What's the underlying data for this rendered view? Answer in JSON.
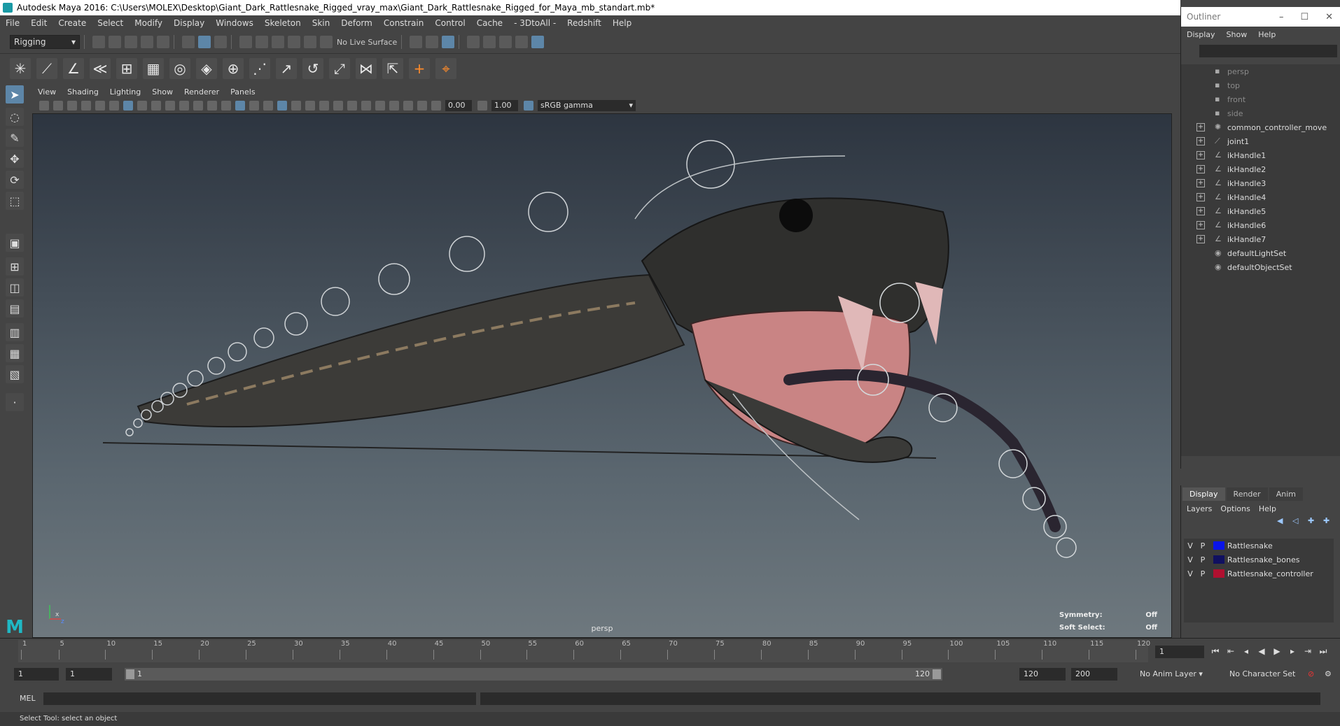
{
  "window": {
    "title": "Autodesk Maya 2016: C:\\Users\\MOLEX\\Desktop\\Giant_Dark_Rattlesnake_Rigged_vray_max\\Giant_Dark_Rattlesnake_Rigged_for_Maya_mb_standart.mb*"
  },
  "menubar": [
    "File",
    "Edit",
    "Create",
    "Select",
    "Modify",
    "Display",
    "Windows",
    "Skeleton",
    "Skin",
    "Deform",
    "Constrain",
    "Control",
    "Cache",
    "- 3DtoAll -",
    "Redshift",
    "Help"
  ],
  "statusline": {
    "mode": "Rigging",
    "live_surface": "No Live Surface"
  },
  "viewport": {
    "menu": [
      "View",
      "Shading",
      "Lighting",
      "Show",
      "Renderer",
      "Panels"
    ],
    "exposure": "0.00",
    "gamma_value": "1.00",
    "color_space": "sRGB gamma",
    "camera": "persp",
    "hud": {
      "symmetry_label": "Symmetry:",
      "symmetry_value": "Off",
      "soft_select_label": "Soft Select:",
      "soft_select_value": "Off"
    },
    "axis_x": "x",
    "axis_z": "z"
  },
  "outliner": {
    "title": "Outliner",
    "menu": [
      "Display",
      "Show",
      "Help"
    ],
    "items": [
      {
        "label": "persp",
        "icon": "camera-icon",
        "expandable": false,
        "dim": true
      },
      {
        "label": "top",
        "icon": "camera-icon",
        "expandable": false,
        "dim": true
      },
      {
        "label": "front",
        "icon": "camera-icon",
        "expandable": false,
        "dim": true
      },
      {
        "label": "side",
        "icon": "camera-icon",
        "expandable": false,
        "dim": true
      },
      {
        "label": "common_controller_move",
        "icon": "controller-icon",
        "expandable": true,
        "dim": false
      },
      {
        "label": "joint1",
        "icon": "joint-icon",
        "expandable": true,
        "dim": false
      },
      {
        "label": "ikHandle1",
        "icon": "ik-handle-icon",
        "expandable": true,
        "dim": false
      },
      {
        "label": "ikHandle2",
        "icon": "ik-handle-icon",
        "expandable": true,
        "dim": false
      },
      {
        "label": "ikHandle3",
        "icon": "ik-handle-icon",
        "expandable": true,
        "dim": false
      },
      {
        "label": "ikHandle4",
        "icon": "ik-handle-icon",
        "expandable": true,
        "dim": false
      },
      {
        "label": "ikHandle5",
        "icon": "ik-handle-icon",
        "expandable": true,
        "dim": false
      },
      {
        "label": "ikHandle6",
        "icon": "ik-handle-icon",
        "expandable": true,
        "dim": false
      },
      {
        "label": "ikHandle7",
        "icon": "ik-handle-icon",
        "expandable": true,
        "dim": false
      },
      {
        "label": "defaultLightSet",
        "icon": "set-icon",
        "expandable": false,
        "dim": false
      },
      {
        "label": "defaultObjectSet",
        "icon": "set-icon",
        "expandable": false,
        "dim": false
      }
    ]
  },
  "layer_editor": {
    "tabs": [
      "Display",
      "Render",
      "Anim"
    ],
    "menu": [
      "Layers",
      "Options",
      "Help"
    ],
    "layers": [
      {
        "v": "V",
        "p": "P",
        "name": "Rattlesnake",
        "color": "#0a14e8"
      },
      {
        "v": "V",
        "p": "P",
        "name": "Rattlesnake_bones",
        "color": "#101060"
      },
      {
        "v": "V",
        "p": "P",
        "name": "Rattlesnake_controller",
        "color": "#b01030"
      }
    ]
  },
  "timeslider": {
    "ticks": [
      "1",
      "5",
      "10",
      "15",
      "20",
      "25",
      "30",
      "35",
      "40",
      "45",
      "50",
      "55",
      "60",
      "65",
      "70",
      "75",
      "80",
      "85",
      "90",
      "95",
      "100",
      "105",
      "110",
      "115",
      "120"
    ],
    "current_frame": "1"
  },
  "range": {
    "start": "1",
    "playback_start": "1",
    "range_low": "1",
    "range_high": "120",
    "playback_end": "120",
    "end": "200",
    "anim_layer": "No Anim Layer",
    "character_set": "No Character Set"
  },
  "command": {
    "mel_label": "MEL",
    "help_text": "Select Tool: select an object"
  },
  "colors": {
    "accent": "#5d86a8",
    "maya_logo": "#1fb8c4"
  }
}
